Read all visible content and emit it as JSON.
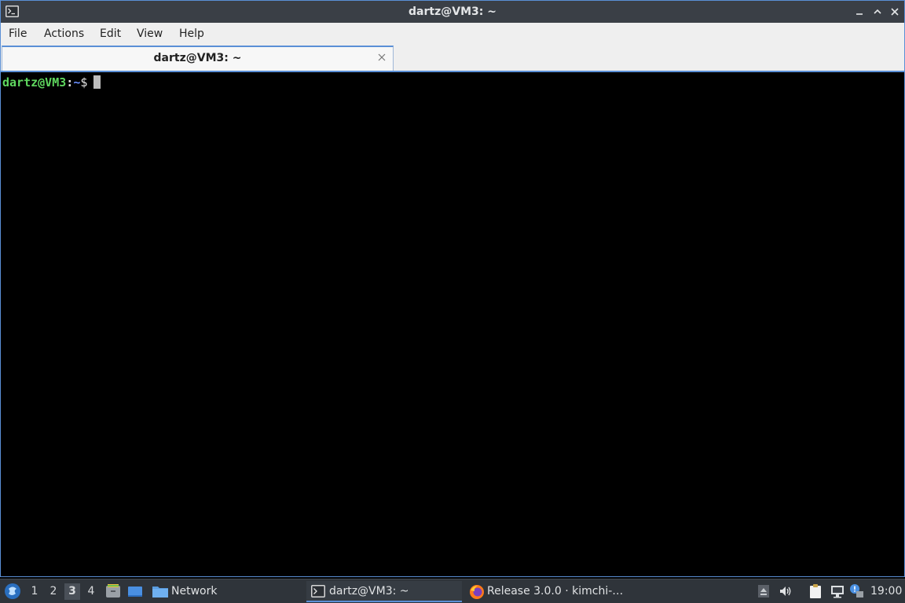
{
  "window": {
    "title": "dartz@VM3: ~"
  },
  "menu": {
    "items": [
      "File",
      "Actions",
      "Edit",
      "View",
      "Help"
    ]
  },
  "tabs": [
    {
      "label": "dartz@VM3: ~"
    }
  ],
  "terminal": {
    "prompt_user_host": "dartz@VM3",
    "prompt_colon": ":",
    "prompt_path": "~",
    "prompt_symbol": "$"
  },
  "taskbar": {
    "workspaces": [
      "1",
      "2",
      "3",
      "4"
    ],
    "active_workspace": "3",
    "network_label": "Network",
    "tasks": [
      {
        "label": "dartz@VM3: ~",
        "icon": "terminal-icon",
        "active": true
      },
      {
        "label": "Release 3.0.0 · kimchi-…",
        "icon": "firefox-icon",
        "active": false
      }
    ],
    "clock": "19:00"
  },
  "colors": {
    "accent": "#5a8fd6",
    "titlebar": "#3a3f46",
    "prompt_user": "#5fd75f",
    "prompt_path": "#6a8fff",
    "taskbar": "#2f343a"
  }
}
